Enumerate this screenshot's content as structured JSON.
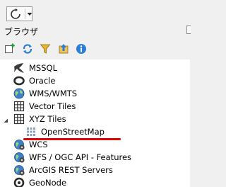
{
  "panel": {
    "title": "ブラウザ"
  },
  "tree": {
    "items": [
      {
        "label": "MSSQL"
      },
      {
        "label": "Oracle"
      },
      {
        "label": "WMS/WMTS"
      },
      {
        "label": "Vector Tiles"
      },
      {
        "label": "XYZ Tiles"
      },
      {
        "label": "OpenStreetMap"
      },
      {
        "label": "WCS"
      },
      {
        "label": "WFS / OGC API - Features"
      },
      {
        "label": "ArcGIS REST Servers"
      },
      {
        "label": "GeoNode"
      }
    ]
  },
  "colors": {
    "highlight_underline": "#e10600",
    "toolbar_blue": "#2a7fd4",
    "filter_yellow": "#e8b52c"
  }
}
